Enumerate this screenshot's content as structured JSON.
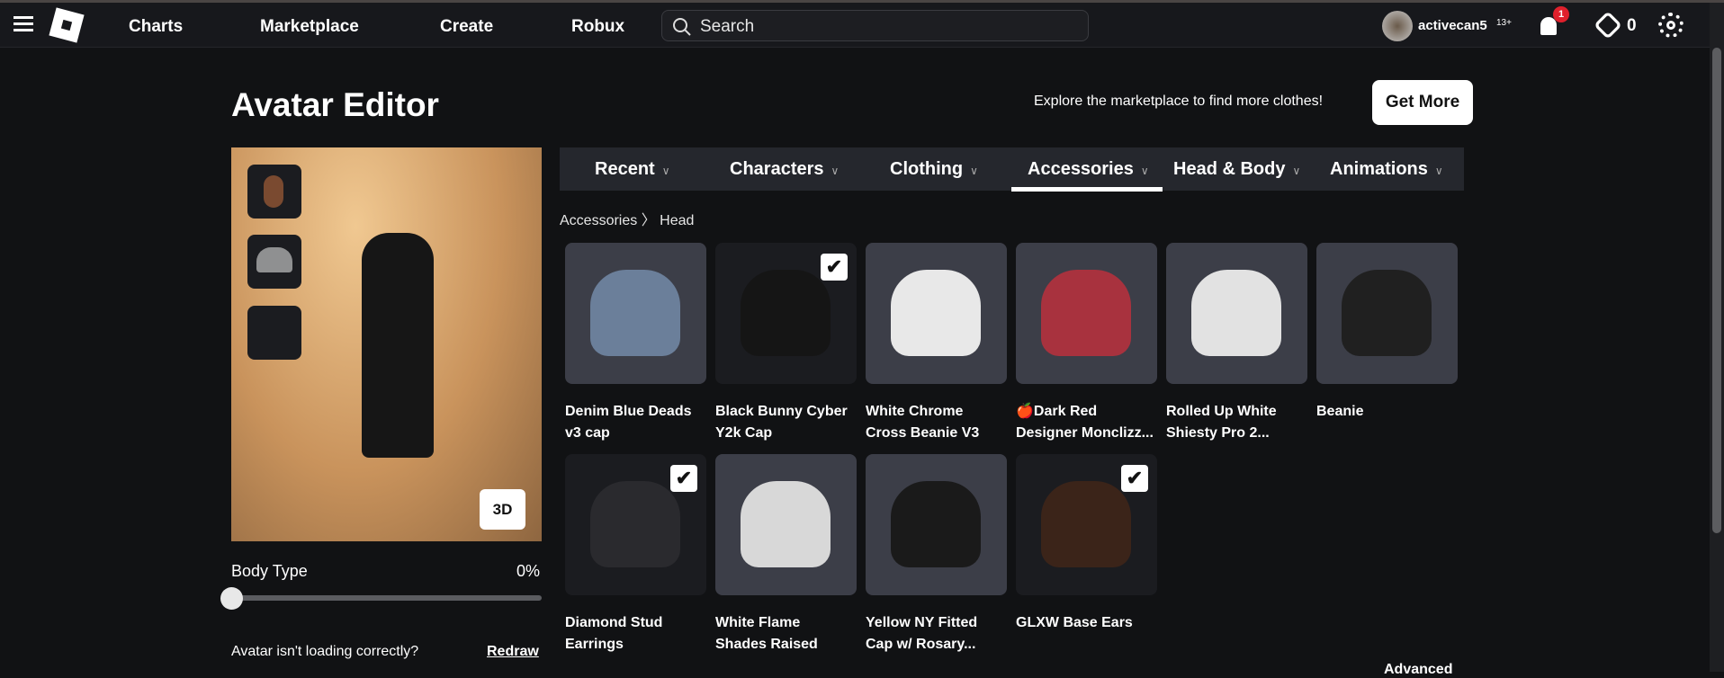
{
  "nav": {
    "menu_icon": "hamburger-icon",
    "logo": "roblox-logo",
    "links": [
      "Charts",
      "Marketplace",
      "Create",
      "Robux"
    ],
    "search_placeholder": "Search",
    "username": "activecan5",
    "age_badge": "13+",
    "notifications": "1",
    "robux": "0"
  },
  "page": {
    "title": "Avatar Editor",
    "explore_text": "Explore the marketplace to find more clothes!",
    "get_more": "Get More"
  },
  "avatar": {
    "view_button": "3D",
    "body_type_label": "Body Type",
    "body_type_value": "0%",
    "body_type_fraction": 0,
    "loading_text": "Avatar isn't loading correctly?",
    "redraw": "Redraw"
  },
  "tabs": [
    {
      "label": "Recent"
    },
    {
      "label": "Characters"
    },
    {
      "label": "Clothing"
    },
    {
      "label": "Accessories",
      "active": true
    },
    {
      "label": "Head & Body"
    },
    {
      "label": "Animations"
    }
  ],
  "breadcrumb": {
    "parent": "Accessories",
    "sep": "〉",
    "current": "Head"
  },
  "items": [
    {
      "name1": "Denim Blue Deads",
      "name2": "v3 cap",
      "selected": false,
      "color": "#6b7f9a"
    },
    {
      "name1": "Black Bunny Cyber",
      "name2": "Y2k Cap",
      "selected": true,
      "color": "#151515"
    },
    {
      "name1": "White Chrome",
      "name2": "Cross Beanie V3",
      "selected": false,
      "color": "#e8e8e8"
    },
    {
      "name1": "🍎Dark Red",
      "name2": "Designer Monclizz...",
      "selected": false,
      "color": "#a8323e"
    },
    {
      "name1": "Rolled Up White",
      "name2": "Shiesty Pro 2...",
      "selected": false,
      "color": "#e2e2e2"
    },
    {
      "name1": "Beanie",
      "name2": "",
      "selected": false,
      "color": "#202020"
    },
    {
      "name1": "Diamond Stud",
      "name2": "Earrings",
      "selected": true,
      "color": "#2a2a2e"
    },
    {
      "name1": "White Flame",
      "name2": "Shades Raised",
      "selected": false,
      "color": "#d8d8d8"
    },
    {
      "name1": "Yellow NY Fitted",
      "name2": "Cap w/ Rosary...",
      "selected": false,
      "color": "#1a1a1a"
    },
    {
      "name1": "GLXW Base Ears",
      "name2": "",
      "selected": true,
      "color": "#3b2419"
    }
  ],
  "footer": {
    "advanced": "Advanced"
  }
}
